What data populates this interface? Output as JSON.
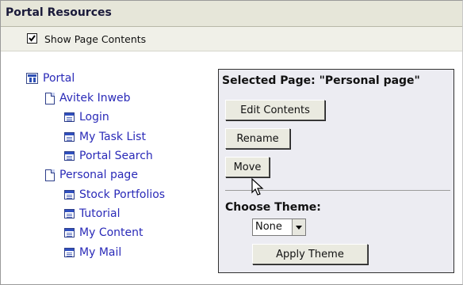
{
  "header": {
    "title": "Portal Resources"
  },
  "toolbar": {
    "show_page_contents_label": "Show Page Contents",
    "show_page_contents_checked": true
  },
  "tree": {
    "root": {
      "label": "Portal",
      "icon": "portal-icon"
    },
    "groups": [
      {
        "label": "Avitek Inweb",
        "icon": "page-icon",
        "children": [
          {
            "label": "Login",
            "icon": "portlet-icon"
          },
          {
            "label": "My Task List",
            "icon": "portlet-icon"
          },
          {
            "label": "Portal Search",
            "icon": "portlet-icon"
          }
        ]
      },
      {
        "label": "Personal page",
        "icon": "page-icon",
        "children": [
          {
            "label": "Stock Portfolios",
            "icon": "portlet-icon"
          },
          {
            "label": "Tutorial",
            "icon": "portlet-icon"
          },
          {
            "label": "My Content",
            "icon": "portlet-icon"
          },
          {
            "label": "My Mail",
            "icon": "portlet-icon"
          }
        ]
      }
    ]
  },
  "panel": {
    "title": "Selected Page: \"Personal page\"",
    "edit_contents_label": "Edit Contents",
    "rename_label": "Rename",
    "move_label": "Move",
    "choose_theme_label": "Choose Theme:",
    "theme_select_value": "None",
    "apply_theme_label": "Apply Theme"
  },
  "colors": {
    "link": "#2a2ab8",
    "header_bg": "#e6e6d9",
    "panel_bg": "#ececf2"
  }
}
